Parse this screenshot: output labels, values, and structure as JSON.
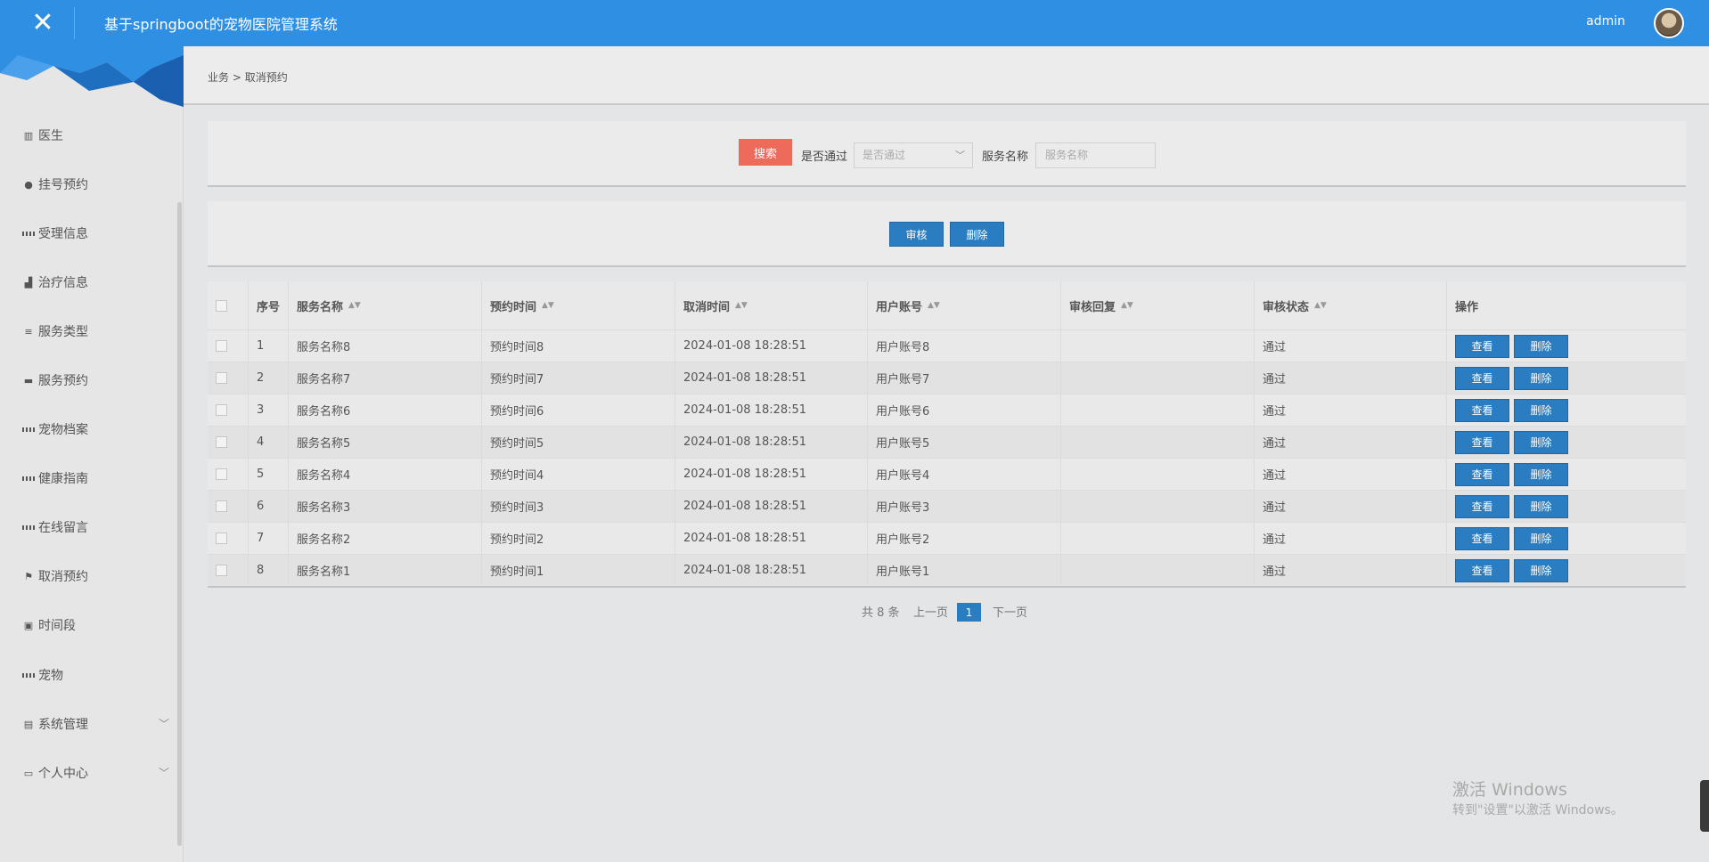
{
  "header": {
    "title": "基于springboot的宠物医院管理系统",
    "user": "admin"
  },
  "sidebar": {
    "items": [
      {
        "label": "医生",
        "icon": "book-icon"
      },
      {
        "label": "挂号预约",
        "icon": "map-marker-icon"
      },
      {
        "label": "受理信息",
        "icon": "grid-icon"
      },
      {
        "label": "治疗信息",
        "icon": "thumbs-up-icon"
      },
      {
        "label": "服务类型",
        "icon": "sliders-icon"
      },
      {
        "label": "服务预约",
        "icon": "briefcase-icon"
      },
      {
        "label": "宠物档案",
        "icon": "grid-icon"
      },
      {
        "label": "健康指南",
        "icon": "grid-icon"
      },
      {
        "label": "在线留言",
        "icon": "grid-icon"
      },
      {
        "label": "取消预约",
        "icon": "flag-icon"
      },
      {
        "label": "时间段",
        "icon": "bus-icon"
      },
      {
        "label": "宠物",
        "icon": "grid-icon"
      },
      {
        "label": "系统管理",
        "icon": "clipboard-icon"
      },
      {
        "label": "个人中心",
        "icon": "id-card-icon"
      }
    ]
  },
  "breadcrumb": {
    "root": "业务",
    "sep": ">",
    "current": "取消预约"
  },
  "search": {
    "button": "搜索",
    "approved_label": "是否通过",
    "approved_placeholder": "是否通过",
    "service_label": "服务名称",
    "service_placeholder": "服务名称"
  },
  "actions": {
    "review": "审核",
    "delete": "删除"
  },
  "table": {
    "headers": [
      "序号",
      "服务名称",
      "预约时间",
      "取消时间",
      "用户账号",
      "审核回复",
      "审核状态",
      "操作"
    ],
    "rows": [
      {
        "no": "1",
        "service": "服务名称8",
        "appt": "预约时间8",
        "cancel": "2024-01-08 18:28:51",
        "account": "用户账号8",
        "reply": "",
        "status": "通过"
      },
      {
        "no": "2",
        "service": "服务名称7",
        "appt": "预约时间7",
        "cancel": "2024-01-08 18:28:51",
        "account": "用户账号7",
        "reply": "",
        "status": "通过"
      },
      {
        "no": "3",
        "service": "服务名称6",
        "appt": "预约时间6",
        "cancel": "2024-01-08 18:28:51",
        "account": "用户账号6",
        "reply": "",
        "status": "通过"
      },
      {
        "no": "4",
        "service": "服务名称5",
        "appt": "预约时间5",
        "cancel": "2024-01-08 18:28:51",
        "account": "用户账号5",
        "reply": "",
        "status": "通过"
      },
      {
        "no": "5",
        "service": "服务名称4",
        "appt": "预约时间4",
        "cancel": "2024-01-08 18:28:51",
        "account": "用户账号4",
        "reply": "",
        "status": "通过"
      },
      {
        "no": "6",
        "service": "服务名称3",
        "appt": "预约时间3",
        "cancel": "2024-01-08 18:28:51",
        "account": "用户账号3",
        "reply": "",
        "status": "通过"
      },
      {
        "no": "7",
        "service": "服务名称2",
        "appt": "预约时间2",
        "cancel": "2024-01-08 18:28:51",
        "account": "用户账号2",
        "reply": "",
        "status": "通过"
      },
      {
        "no": "8",
        "service": "服务名称1",
        "appt": "预约时间1",
        "cancel": "2024-01-08 18:28:51",
        "account": "用户账号1",
        "reply": "",
        "status": "通过"
      }
    ],
    "view_label": "查看",
    "delete_label": "删除"
  },
  "pagination": {
    "total": "共 8 条",
    "prev": "上一页",
    "current": "1",
    "next": "下一页"
  },
  "watermark": {
    "line1": "激活 Windows",
    "line2": "转到\"设置\"以激活 Windows。"
  },
  "colors": {
    "primary": "#2f8fe3",
    "button": "#2b7dc1",
    "search": "#ee6b5b"
  }
}
